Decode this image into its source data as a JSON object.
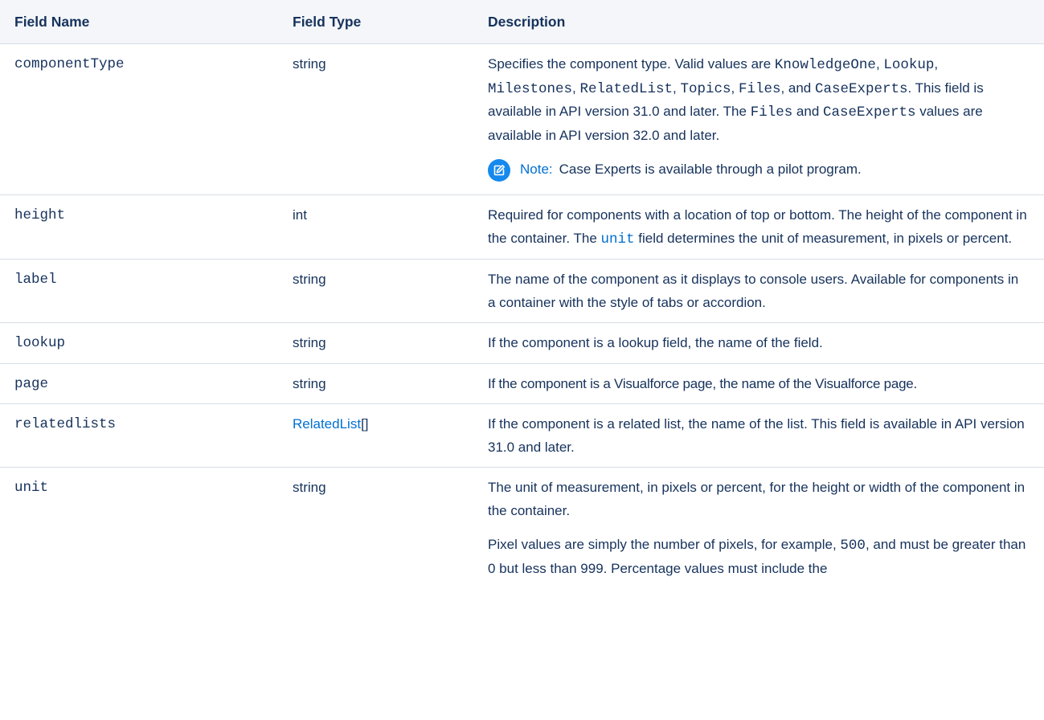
{
  "headers": {
    "field_name": "Field Name",
    "field_type": "Field Type",
    "description": "Description"
  },
  "rows": {
    "componentType": {
      "name": "componentType",
      "type": "string",
      "d": [
        "Specifies the component type. Valid values are ",
        "KnowledgeOne",
        ", ",
        "Lookup",
        ", ",
        "Milestones",
        ", ",
        "RelatedList",
        ", ",
        "Topics",
        ", ",
        "Files",
        ", and ",
        "CaseExperts",
        ". This field is available in API version 31.0 and later. The ",
        "Files",
        " and ",
        "CaseExperts",
        " values are available in API version 32.0 and later."
      ],
      "note_label": "Note:",
      "note_text": "Case Experts is available through a pilot program."
    },
    "height": {
      "name": "height",
      "type": "int",
      "d1": "Required for components with a location of top or bottom. The height of the component in the container. The ",
      "link": "unit",
      "d2": " field determines the unit of measurement, in pixels or percent."
    },
    "label": {
      "name": "label",
      "type": "string",
      "d": "The name of the component as it displays to console users. Available for components in a container with the style of tabs or accordion."
    },
    "lookup": {
      "name": "lookup",
      "type": "string",
      "d": "If the component is a lookup field, the name of the field."
    },
    "page": {
      "name": "page",
      "type": "string",
      "d": "If the component is a Visualforce page, the name of the Visualforce page."
    },
    "relatedlists": {
      "name": "relatedlists",
      "type_link": "RelatedList",
      "type_suffix": "[]",
      "d": "If the component is a related list, the name of the list. This field is available in API version 31.0 and later."
    },
    "unit": {
      "name": "unit",
      "type": "string",
      "d": "The unit of measurement, in pixels or percent, for the height or width of the component in the container.",
      "p2a": "Pixel values are simply the number of pixels, for example, ",
      "p2code": "500",
      "p2b": ", and must be greater than 0 but less than 999. Percentage values must include the"
    }
  }
}
